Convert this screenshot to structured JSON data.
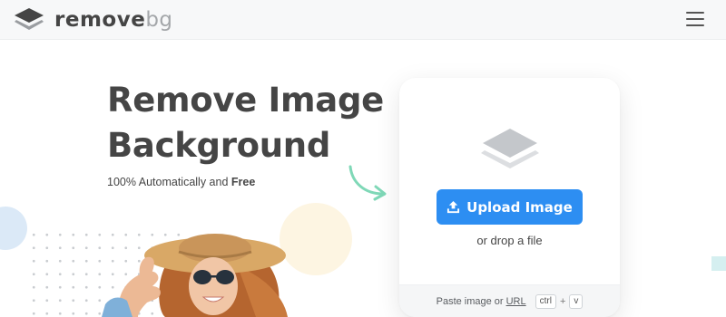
{
  "header": {
    "logo_bold": "remove",
    "logo_light": "bg",
    "menu_icon": "hamburger-menu-icon"
  },
  "hero": {
    "title_line1": "Remove Image",
    "title_line2": "Background",
    "subtitle_prefix": "100% Automatically and ",
    "subtitle_highlight": "Free"
  },
  "upload_card": {
    "icon": "layers-icon",
    "upload_button_label": "Upload Image",
    "upload_button_icon": "upload-arrow-icon",
    "drop_text": "or drop a file",
    "paste_prefix": "Paste image or",
    "paste_url_link": "URL",
    "shortcut_key1": "ctrl",
    "shortcut_plus": "+",
    "shortcut_key2": "v"
  },
  "colors": {
    "accent_blue": "#2d8ef2",
    "highlight_green": "#9ee3c9",
    "text_dark": "#454545",
    "arrow_teal": "#7fd8b7"
  }
}
